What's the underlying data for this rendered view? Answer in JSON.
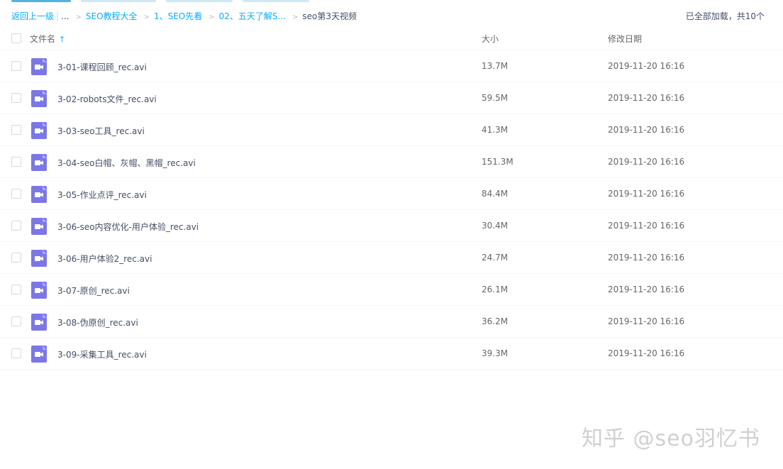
{
  "breadcrumb": {
    "back": "返回上一级",
    "ellipsis": "...",
    "items": [
      "SEO教程大全",
      "1、SEO先看",
      "02、五天了解S..."
    ],
    "current": "seo第3天视频"
  },
  "status": "已全部加载，共10个",
  "columns": {
    "name": "文件名",
    "size": "大小",
    "date": "修改日期"
  },
  "icons": {
    "file": "video-file-icon",
    "sort": "sort-ascending-arrow-icon",
    "file_color": "#7b77e6"
  },
  "files": [
    {
      "name": "3-01-课程回顾_rec.avi",
      "size": "13.7M",
      "date": "2019-11-20 16:16"
    },
    {
      "name": "3-02-robots文件_rec.avi",
      "size": "59.5M",
      "date": "2019-11-20 16:16"
    },
    {
      "name": "3-03-seo工具_rec.avi",
      "size": "41.3M",
      "date": "2019-11-20 16:16"
    },
    {
      "name": "3-04-seo白帽、灰帽、黑帽_rec.avi",
      "size": "151.3M",
      "date": "2019-11-20 16:16"
    },
    {
      "name": "3-05-作业点评_rec.avi",
      "size": "84.4M",
      "date": "2019-11-20 16:16"
    },
    {
      "name": "3-06-seo内容优化-用户体验_rec.avi",
      "size": "30.4M",
      "date": "2019-11-20 16:16"
    },
    {
      "name": "3-06-用户体验2_rec.avi",
      "size": "24.7M",
      "date": "2019-11-20 16:16"
    },
    {
      "name": "3-07-原创_rec.avi",
      "size": "26.1M",
      "date": "2019-11-20 16:16"
    },
    {
      "name": "3-08-伪原创_rec.avi",
      "size": "36.2M",
      "date": "2019-11-20 16:16"
    },
    {
      "name": "3-09-采集工具_rec.avi",
      "size": "39.3M",
      "date": "2019-11-20 16:16"
    }
  ],
  "watermark": "知乎 @seo羽忆书"
}
